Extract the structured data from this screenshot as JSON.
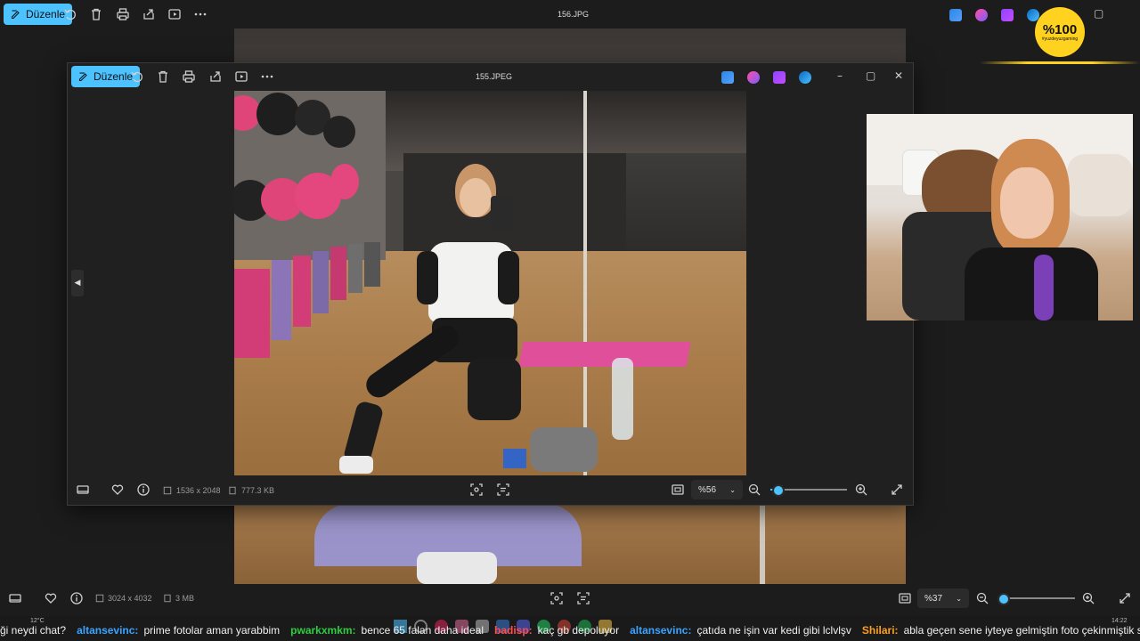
{
  "back_window": {
    "edit_label": "Düzenle",
    "title": "156.JPG",
    "dimensions": "3024 x 4032",
    "size": "3 MB",
    "zoom": "%37",
    "zoom_level": 0.05
  },
  "front_window": {
    "edit_label": "Düzenle",
    "title": "155.JPEG",
    "dimensions": "1536 x 2048",
    "size": "777.3 KB",
    "zoom": "%56",
    "zoom_level": 0.1
  },
  "overlay": {
    "logo_text": "%100",
    "logo_sub": "#yuzdeyuzgaming"
  },
  "taskbar": {
    "weather": "12°C",
    "time": "14:22"
  },
  "chat": [
    {
      "user": "",
      "message": "ği neydi chat?",
      "color": "#ffffff"
    },
    {
      "user": "altansevinc:",
      "message": "prime fotolar aman yarabbim",
      "color": "#3aa3ff"
    },
    {
      "user": "pwarkxmkm:",
      "message": "bence 65 falan daha ideal",
      "color": "#2ecc40"
    },
    {
      "user": "badisp:",
      "message": "kaç gb depoluyor",
      "color": "#ff4d4d"
    },
    {
      "user": "altansevinc:",
      "message": "çatıda ne işin var kedi gibi lclvlşv",
      "color": "#3aa3ff"
    },
    {
      "user": "Shilari:",
      "message": "abla geçen sene iyteye gelmiştin foto çekinmiştik seninle",
      "color": "#ff9f1c"
    }
  ],
  "colors": {
    "accent": "#4cc2ff",
    "background": "#1c1c1c",
    "window": "#202020"
  }
}
